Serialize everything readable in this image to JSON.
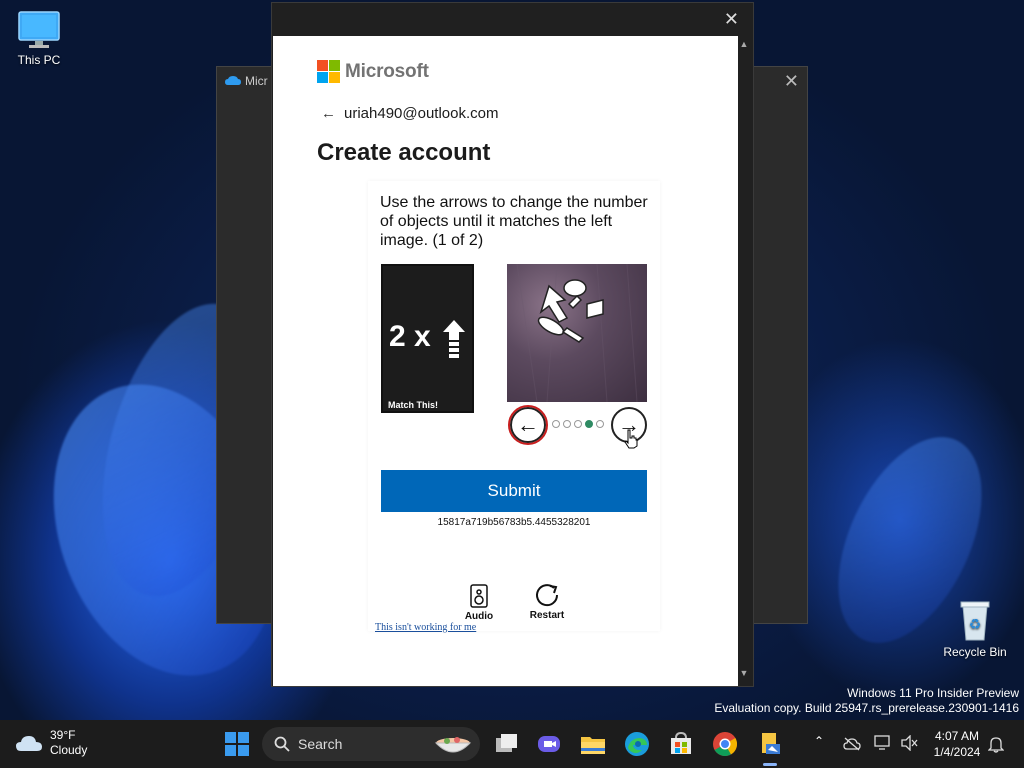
{
  "desktop": {
    "icons": [
      {
        "label": "This PC"
      },
      {
        "label": "Recycle Bin"
      }
    ],
    "watermark": {
      "line1": "Windows 11 Pro Insider Preview",
      "line2": "Evaluation copy. Build 25947.rs_prerelease.230901-1416"
    }
  },
  "background_window": {
    "title": "Micr",
    "close_icon": "close-icon"
  },
  "dialog": {
    "close_icon": "close-icon",
    "brand": "Microsoft",
    "brand_colors": [
      "#f25022",
      "#7fba00",
      "#00a4ef",
      "#ffb900"
    ],
    "account_email": "uriah490@outlook.com",
    "title": "Create account",
    "captcha": {
      "instruction": "Use the arrows to change the number of objects until it matches the left image. (1 of 2)",
      "target_text": "2 x",
      "target_caption": "Match This!",
      "selected_index": 4,
      "total_positions": 5,
      "submit_label": "Submit",
      "session_id": "15817a719b56783b5.4455328201",
      "audio_label": "Audio",
      "restart_label": "Restart",
      "help_link": "This isn't working for me"
    },
    "accent_color": "#0067b8"
  },
  "taskbar": {
    "weather": {
      "temp": "39°F",
      "condition": "Cloudy"
    },
    "search_label": "Search",
    "apps": [
      "task-view-icon",
      "meet-icon",
      "file-explorer-icon",
      "edge-icon",
      "store-icon",
      "chrome-icon",
      "active-app-icon"
    ],
    "clock": {
      "time": "4:07 AM",
      "date": "1/4/2024"
    }
  }
}
